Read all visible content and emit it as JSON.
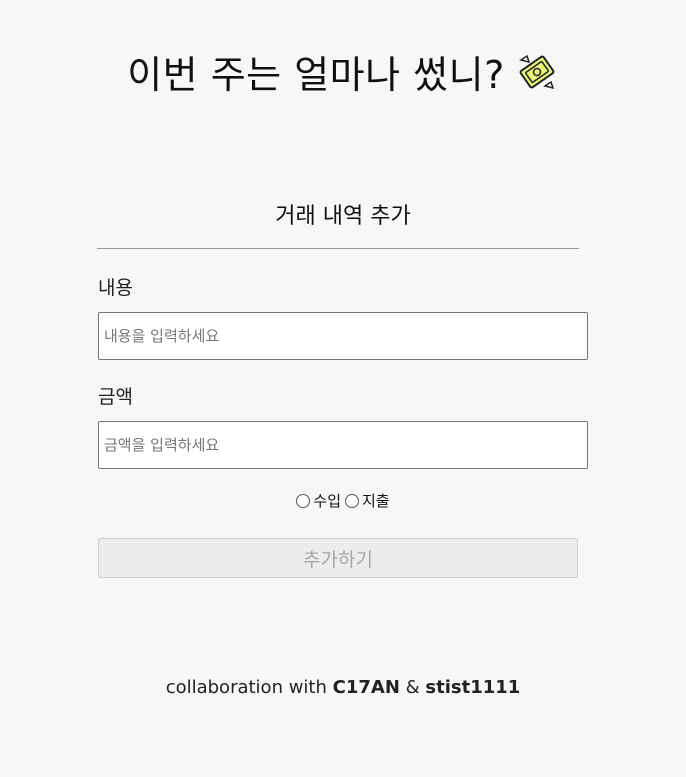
{
  "header": {
    "title": "이번 주는 얼마나 썼니?",
    "title_icon": "money-with-wings-icon"
  },
  "form": {
    "heading": "거래 내역 추가",
    "content_label": "내용",
    "content_placeholder": "내용을 입력하세요",
    "content_value": "",
    "amount_label": "금액",
    "amount_placeholder": "금액을 입력하세요",
    "amount_value": "",
    "type_options": [
      "수입",
      "지출"
    ],
    "selected_type": null,
    "submit_label": "추가하기"
  },
  "footer": {
    "prefix": "collaboration with",
    "author1": "C17AN",
    "separator": "&",
    "author2": "stist1111"
  },
  "colors": {
    "background": "#f7f7f7",
    "divider": "#9a9a9a",
    "button_bg": "#ececec",
    "button_text": "#a8a8a8",
    "emoji_accent": "#d9f23a"
  }
}
